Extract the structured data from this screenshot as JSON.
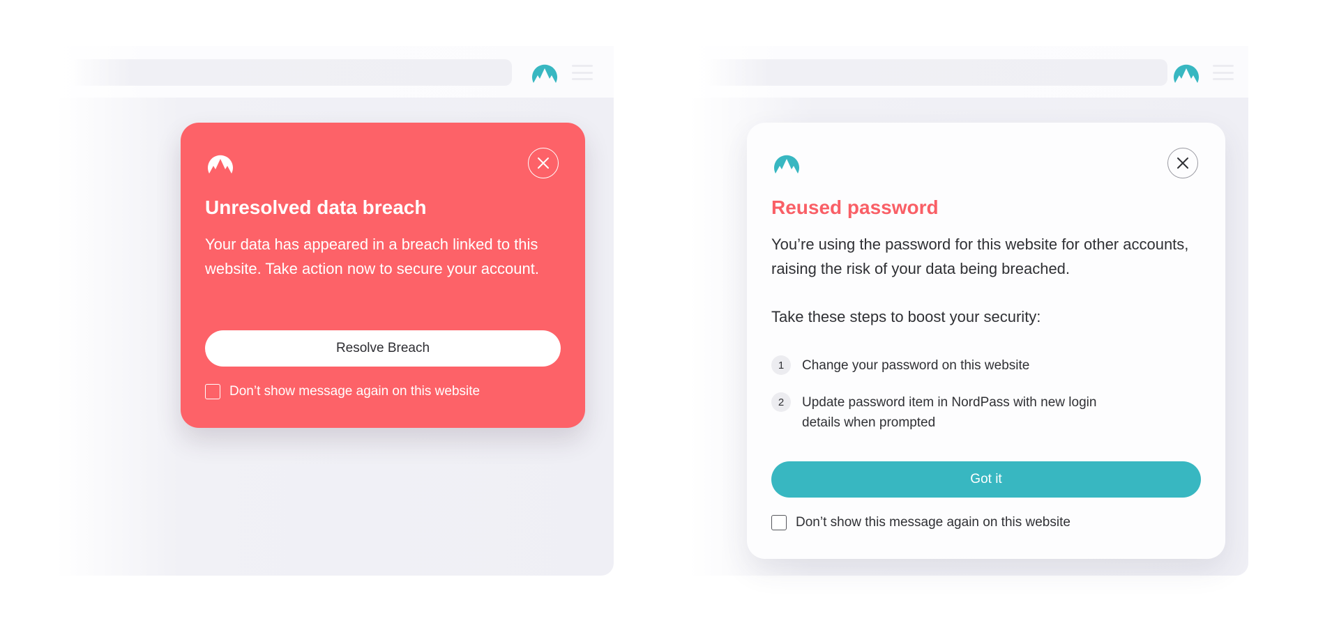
{
  "colors": {
    "brand_teal": "#38b7c1",
    "breach_red": "#fd6268",
    "title_red": "#f95f66",
    "text_dark": "#2f3034",
    "address_bar": "#efeff4"
  },
  "icons": {
    "extension_logo": "nordpass-mountain-logo",
    "menu": "hamburger-icon",
    "close": "close-icon"
  },
  "breach_popup": {
    "logo": "nordpass-mountain-logo",
    "close_icon": "close-icon",
    "title": "Unresolved data breach",
    "body": "Your data has appeared in a breach linked to this website. Take action now to secure your account.",
    "button_label": "Resolve Breach",
    "checkbox_label": "Don’t show message again on this website",
    "checkbox_checked": false
  },
  "reused_popup": {
    "logo": "nordpass-mountain-logo",
    "close_icon": "close-icon",
    "title": "Reused password",
    "body": "You’re using the password for this website for other accounts, raising the risk of your data being breached.",
    "steps_intro": "Take these steps to boost your security:",
    "steps": [
      {
        "number": "1",
        "text": "Change your password on this website"
      },
      {
        "number": "2",
        "text": "Update password item in NordPass with new login details when prompted"
      }
    ],
    "button_label": "Got it",
    "checkbox_label": "Don’t show this message again on this website",
    "checkbox_checked": false
  }
}
